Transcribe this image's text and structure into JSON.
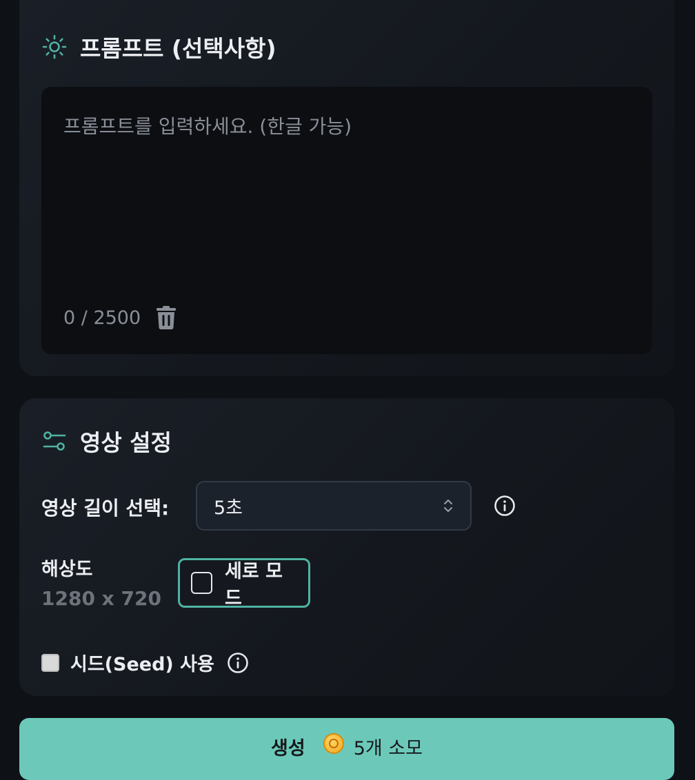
{
  "prompt_section": {
    "title": "프롬프트 (선택사항)",
    "placeholder": "프롬프트를 입력하세요. (한글 가능)",
    "counter": "0 / 2500"
  },
  "settings_section": {
    "title": "영상 설정",
    "duration_label": "영상 길이 선택:",
    "duration_value": "5초",
    "resolution_label": "해상도",
    "resolution_value": "1280 x 720",
    "portrait_mode_label": "세로 모드",
    "seed_label": "시드(Seed) 사용"
  },
  "generate_button": {
    "label": "생성",
    "cost": "5개 소모"
  },
  "colors": {
    "accent": "#6cc9b9",
    "toggle_border": "#4fb3a2",
    "background": "#0e1116"
  },
  "icons": [
    "sun-icon",
    "trash-icon",
    "sliders-icon",
    "chevron-updown-icon",
    "info-icon",
    "coin-icon"
  ]
}
